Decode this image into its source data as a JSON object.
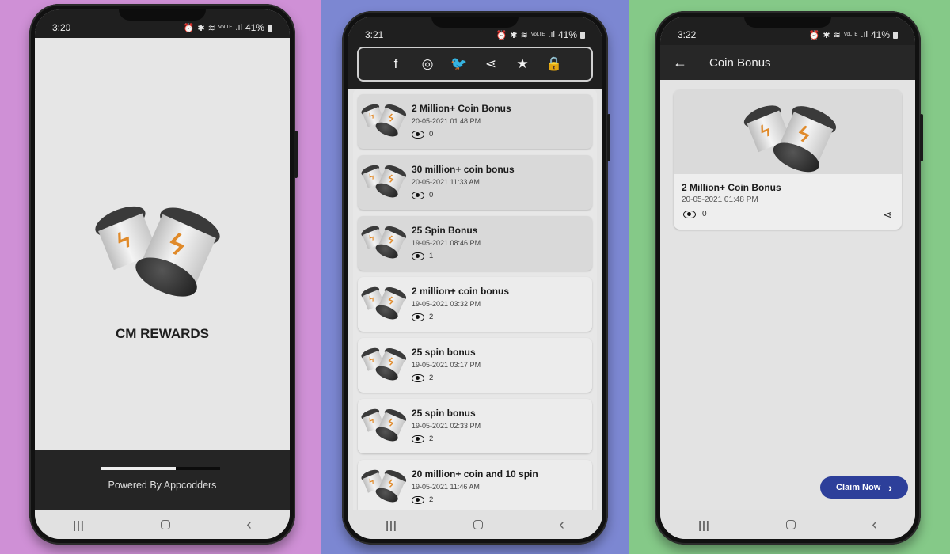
{
  "backgrounds": {
    "left": "#cf90d6",
    "middle": "#7c87d2",
    "right": "#85c988"
  },
  "status_icons": {
    "alarm": "⏰",
    "bluetooth": "✱",
    "wifi": "≋",
    "volte": "VoLTE",
    "signal": ".ıl",
    "battery_percent": "41%"
  },
  "nav_icons": {
    "recent": "|||",
    "back": "‹"
  },
  "splash": {
    "time": "3:20",
    "app_name": "CM REWARDS",
    "progress_percent": 63,
    "powered_by": "Powered By Appcodders"
  },
  "list_screen": {
    "time": "3:21",
    "social_icons": [
      {
        "name": "facebook-icon",
        "glyph": "f"
      },
      {
        "name": "instagram-icon",
        "glyph": "◎"
      },
      {
        "name": "twitter-icon",
        "glyph": "🐦"
      },
      {
        "name": "share-icon",
        "glyph": "⋖"
      },
      {
        "name": "star-icon",
        "glyph": "★"
      },
      {
        "name": "lock-icon",
        "glyph": "🔒"
      }
    ],
    "items": [
      {
        "title": "2 Million+ Coin Bonus",
        "date": "20-05-2021 01:48 PM",
        "views": "0",
        "dim": true
      },
      {
        "title": "30 million+ coin bonus",
        "date": "20-05-2021 11:33 AM",
        "views": "0",
        "dim": true
      },
      {
        "title": "25 Spin Bonus",
        "date": "19-05-2021 08:46 PM",
        "views": "1",
        "dim": true
      },
      {
        "title": "2 million+ coin bonus",
        "date": "19-05-2021 03:32 PM",
        "views": "2",
        "dim": false
      },
      {
        "title": "25 spin bonus",
        "date": "19-05-2021 03:17 PM",
        "views": "2",
        "dim": false
      },
      {
        "title": "25 spin bonus",
        "date": "19-05-2021 02:33 PM",
        "views": "2",
        "dim": false
      },
      {
        "title": "20 million+ coin and 10 spin",
        "date": "19-05-2021 11:46 AM",
        "views": "2",
        "dim": false
      }
    ]
  },
  "detail_screen": {
    "time": "3:22",
    "back_icon": "←",
    "title": "Coin Bonus",
    "item_title": "2 Million+ Coin Bonus",
    "item_date": "20-05-2021 01:48 PM",
    "item_views": "0",
    "share_icon": "⋖",
    "claim_label": "Claim Now",
    "claim_icon": "›",
    "claim_color": "#2d3f9a"
  }
}
